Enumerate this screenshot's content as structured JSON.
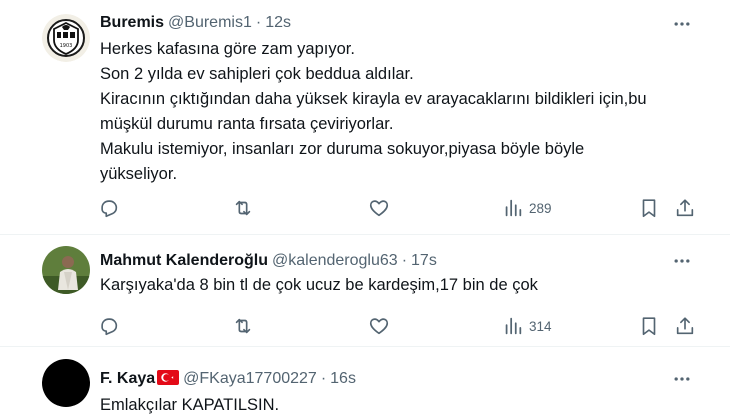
{
  "tweets": [
    {
      "name": "Buremis",
      "handle": "@Buremis1",
      "time": "12s",
      "lines": [
        "Herkes kafasına göre zam yapıyor.",
        "Son 2 yılda ev sahipleri çok beddua aldılar.",
        "Kiracının çıktığından daha yüksek kirayla ev arayacaklarını bildikleri için,bu",
        "müşkül durumu ranta fırsata çeviriyorlar.",
        "Makulu istemiyor, insanları zor duruma sokuyor,piyasa böyle böyle",
        "yükseliyor."
      ],
      "views": "289",
      "avatar": "logo-icon"
    },
    {
      "name": "Mahmut Kalenderoğlu",
      "handle": "@kalenderoglu63",
      "time": "17s",
      "lines": [
        "Karşıyaka'da 8 bin tl de çok ucuz be kardeşim,17 bin de çok"
      ],
      "views": "314",
      "avatar": "person-photo"
    },
    {
      "name": "F. Kaya",
      "handle": "@FKaya17700227",
      "time": "16s",
      "lines": [
        "Emlakçılar KAPATILSIN."
      ],
      "avatar": "black-circle",
      "name_badge": "turkey-flag-icon"
    }
  ],
  "separator": "·",
  "colors": {
    "text": "#0f1419",
    "secondary": "#536471",
    "divider": "#eff3f4",
    "flag": "#e30a17"
  }
}
